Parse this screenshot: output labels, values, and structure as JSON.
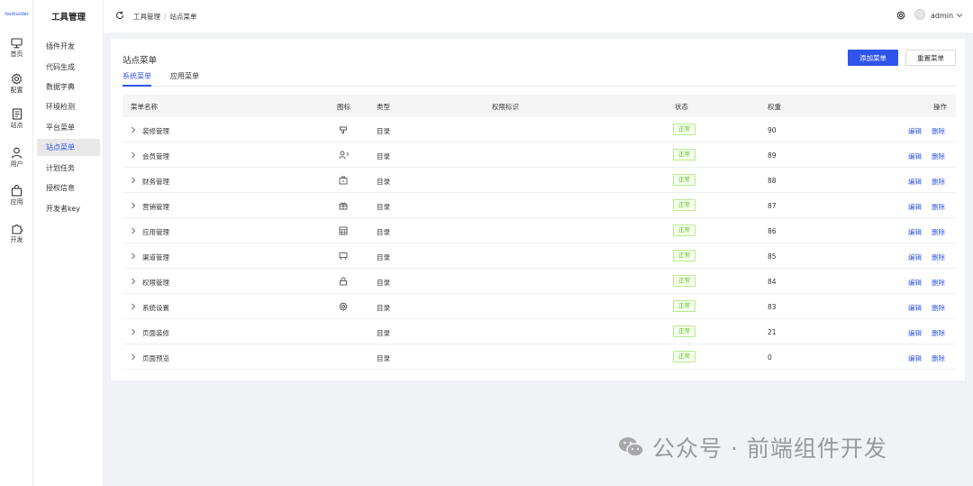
{
  "logo_text": "fastbuilder",
  "main_nav": [
    {
      "label": "首页",
      "icon": "monitor-icon"
    },
    {
      "label": "配置",
      "icon": "gear-icon"
    },
    {
      "label": "站点",
      "icon": "document-icon"
    },
    {
      "label": "用户",
      "icon": "user-icon"
    },
    {
      "label": "应用",
      "icon": "bag-icon"
    },
    {
      "label": "开发",
      "icon": "puzzle-icon"
    }
  ],
  "submenu": {
    "title": "工具管理",
    "items": [
      {
        "label": "插件开发",
        "active": false
      },
      {
        "label": "代码生成",
        "active": false
      },
      {
        "label": "数据字典",
        "active": false
      },
      {
        "label": "环境检测",
        "active": false
      },
      {
        "label": "平台菜单",
        "active": false
      },
      {
        "label": "站点菜单",
        "active": true
      },
      {
        "label": "计划任务",
        "active": false
      },
      {
        "label": "授权信息",
        "active": false
      },
      {
        "label": "开发者key",
        "active": false
      }
    ]
  },
  "breadcrumb": [
    "工具管理",
    "站点菜单"
  ],
  "breadcrumb_sep": "/",
  "user": {
    "name": "admin"
  },
  "card": {
    "title": "站点菜单",
    "add_button": "添加菜单",
    "reset_button": "重置菜单",
    "tabs": [
      {
        "label": "系统菜单",
        "active": true
      },
      {
        "label": "应用菜单",
        "active": false
      }
    ]
  },
  "table": {
    "headers": {
      "name": "菜单名称",
      "icon": "图标",
      "type": "类型",
      "perm": "权限标识",
      "status": "状态",
      "weight": "权重",
      "ops": "操作"
    },
    "rows": [
      {
        "name": "装修管理",
        "icon": "brush-icon",
        "type": "目录",
        "status": "正常",
        "weight": "90"
      },
      {
        "name": "会员管理",
        "icon": "users-icon",
        "type": "目录",
        "status": "正常",
        "weight": "89"
      },
      {
        "name": "财务管理",
        "icon": "wallet-icon",
        "type": "目录",
        "status": "正常",
        "weight": "88"
      },
      {
        "name": "营销管理",
        "icon": "gift-icon",
        "type": "目录",
        "status": "正常",
        "weight": "87"
      },
      {
        "name": "应用管理",
        "icon": "grid-icon",
        "type": "目录",
        "status": "正常",
        "weight": "86"
      },
      {
        "name": "渠道管理",
        "icon": "easel-icon",
        "type": "目录",
        "status": "正常",
        "weight": "85"
      },
      {
        "name": "权限管理",
        "icon": "lock-icon",
        "type": "目录",
        "status": "正常",
        "weight": "84"
      },
      {
        "name": "系统设置",
        "icon": "gear-icon",
        "type": "目录",
        "status": "正常",
        "weight": "83"
      },
      {
        "name": "页面装修",
        "icon": "",
        "type": "目录",
        "status": "正常",
        "weight": "21"
      },
      {
        "name": "页面预览",
        "icon": "",
        "type": "目录",
        "status": "正常",
        "weight": "0"
      }
    ],
    "edit_label": "编辑",
    "delete_label": "删除"
  },
  "watermark": "公众号 · 前端组件开发",
  "colors": {
    "accent": "#2f54eb",
    "status_green": "#52c41a"
  }
}
